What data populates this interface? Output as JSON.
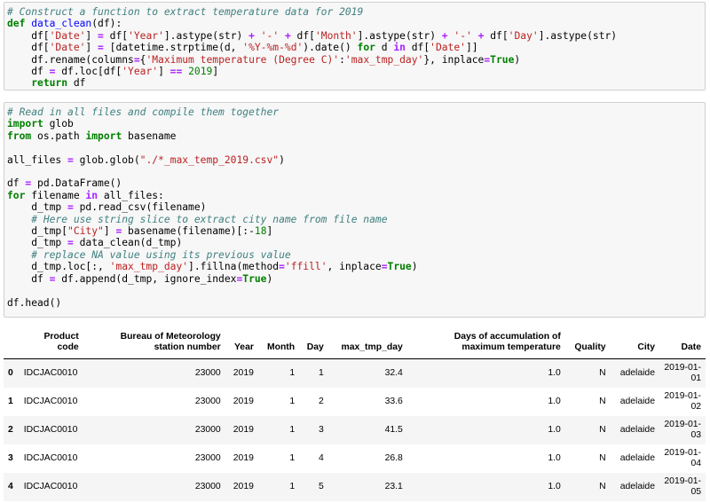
{
  "cells": {
    "cell1": [
      "# Construct a function to extract temperature data for 2019",
      "def data_clean(df):",
      "    df['Date'] = df['Year'].astype(str) + '-' + df['Month'].astype(str) + '-' + df['Day'].astype(str)",
      "    df['Date'] = [datetime.strptime(d, '%Y-%m-%d').date() for d in df['Date']]",
      "    df.rename(columns={'Maximum temperature (Degree C)':'max_tmp_day'}, inplace=True)",
      "    df = df.loc[df['Year'] == 2019]",
      "    return df"
    ],
    "cell2": [
      "# Read in all files and compile them together",
      "import glob",
      "from os.path import basename",
      "",
      "all_files = glob.glob(\"./*_max_temp_2019.csv\")",
      "",
      "df = pd.DataFrame()",
      "for filename in all_files:",
      "    d_tmp = pd.read_csv(filename)",
      "    # Here use string slice to extract city name from file name",
      "    d_tmp[\"City\"] = basename(filename)[:-18]",
      "    d_tmp = data_clean(d_tmp)",
      "    # replace NA value using its previous value",
      "    d_tmp.loc[:, 'max_tmp_day'].fillna(method='ffill', inplace=True)",
      "    df = df.append(d_tmp, ignore_index=True)",
      "",
      "df.head()"
    ]
  },
  "table": {
    "headers": [
      "",
      "Product code",
      "Bureau of Meteorology station number",
      "Year",
      "Month",
      "Day",
      "max_tmp_day",
      "Days of accumulation of maximum temperature",
      "Quality",
      "City",
      "Date"
    ],
    "rows": [
      [
        "0",
        "IDCJAC0010",
        "23000",
        "2019",
        "1",
        "1",
        "32.4",
        "1.0",
        "N",
        "adelaide",
        "2019-01-01"
      ],
      [
        "1",
        "IDCJAC0010",
        "23000",
        "2019",
        "1",
        "2",
        "33.6",
        "1.0",
        "N",
        "adelaide",
        "2019-01-02"
      ],
      [
        "2",
        "IDCJAC0010",
        "23000",
        "2019",
        "1",
        "3",
        "41.5",
        "1.0",
        "N",
        "adelaide",
        "2019-01-03"
      ],
      [
        "3",
        "IDCJAC0010",
        "23000",
        "2019",
        "1",
        "4",
        "26.8",
        "1.0",
        "N",
        "adelaide",
        "2019-01-04"
      ],
      [
        "4",
        "IDCJAC0010",
        "23000",
        "2019",
        "1",
        "5",
        "23.1",
        "1.0",
        "N",
        "adelaide",
        "2019-01-05"
      ]
    ]
  }
}
